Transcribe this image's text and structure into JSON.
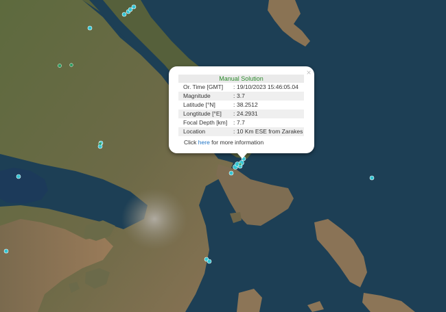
{
  "map": {
    "colors": {
      "sea": "#1d3f55",
      "land": "#56603b",
      "land_dry": "#8c7255",
      "urban": "#9e9a92",
      "lake": "#1c3a5a",
      "marker": "#35c5d3",
      "marker_green": "#2e9e62"
    },
    "epicenter_count": 22
  },
  "popup": {
    "title": "Manual Solution",
    "rows": [
      {
        "label": "Or. Time [GMT]",
        "value": "19/10/2023 15:46:05.04"
      },
      {
        "label": "Magnitude",
        "value": "3.7"
      },
      {
        "label": "Latitude [°N]",
        "value": "38.2512"
      },
      {
        "label": "Longtitude [°E]",
        "value": "24.2931"
      },
      {
        "label": "Focal Depth [km]",
        "value": "7.7"
      },
      {
        "label": "Location",
        "value": "10 Km ESE from Zarakes"
      }
    ],
    "separator": ":",
    "more_prefix": "Click ",
    "more_link": "here",
    "more_suffix": " for more information",
    "close_symbol": "×",
    "close_icon": "close-icon"
  }
}
